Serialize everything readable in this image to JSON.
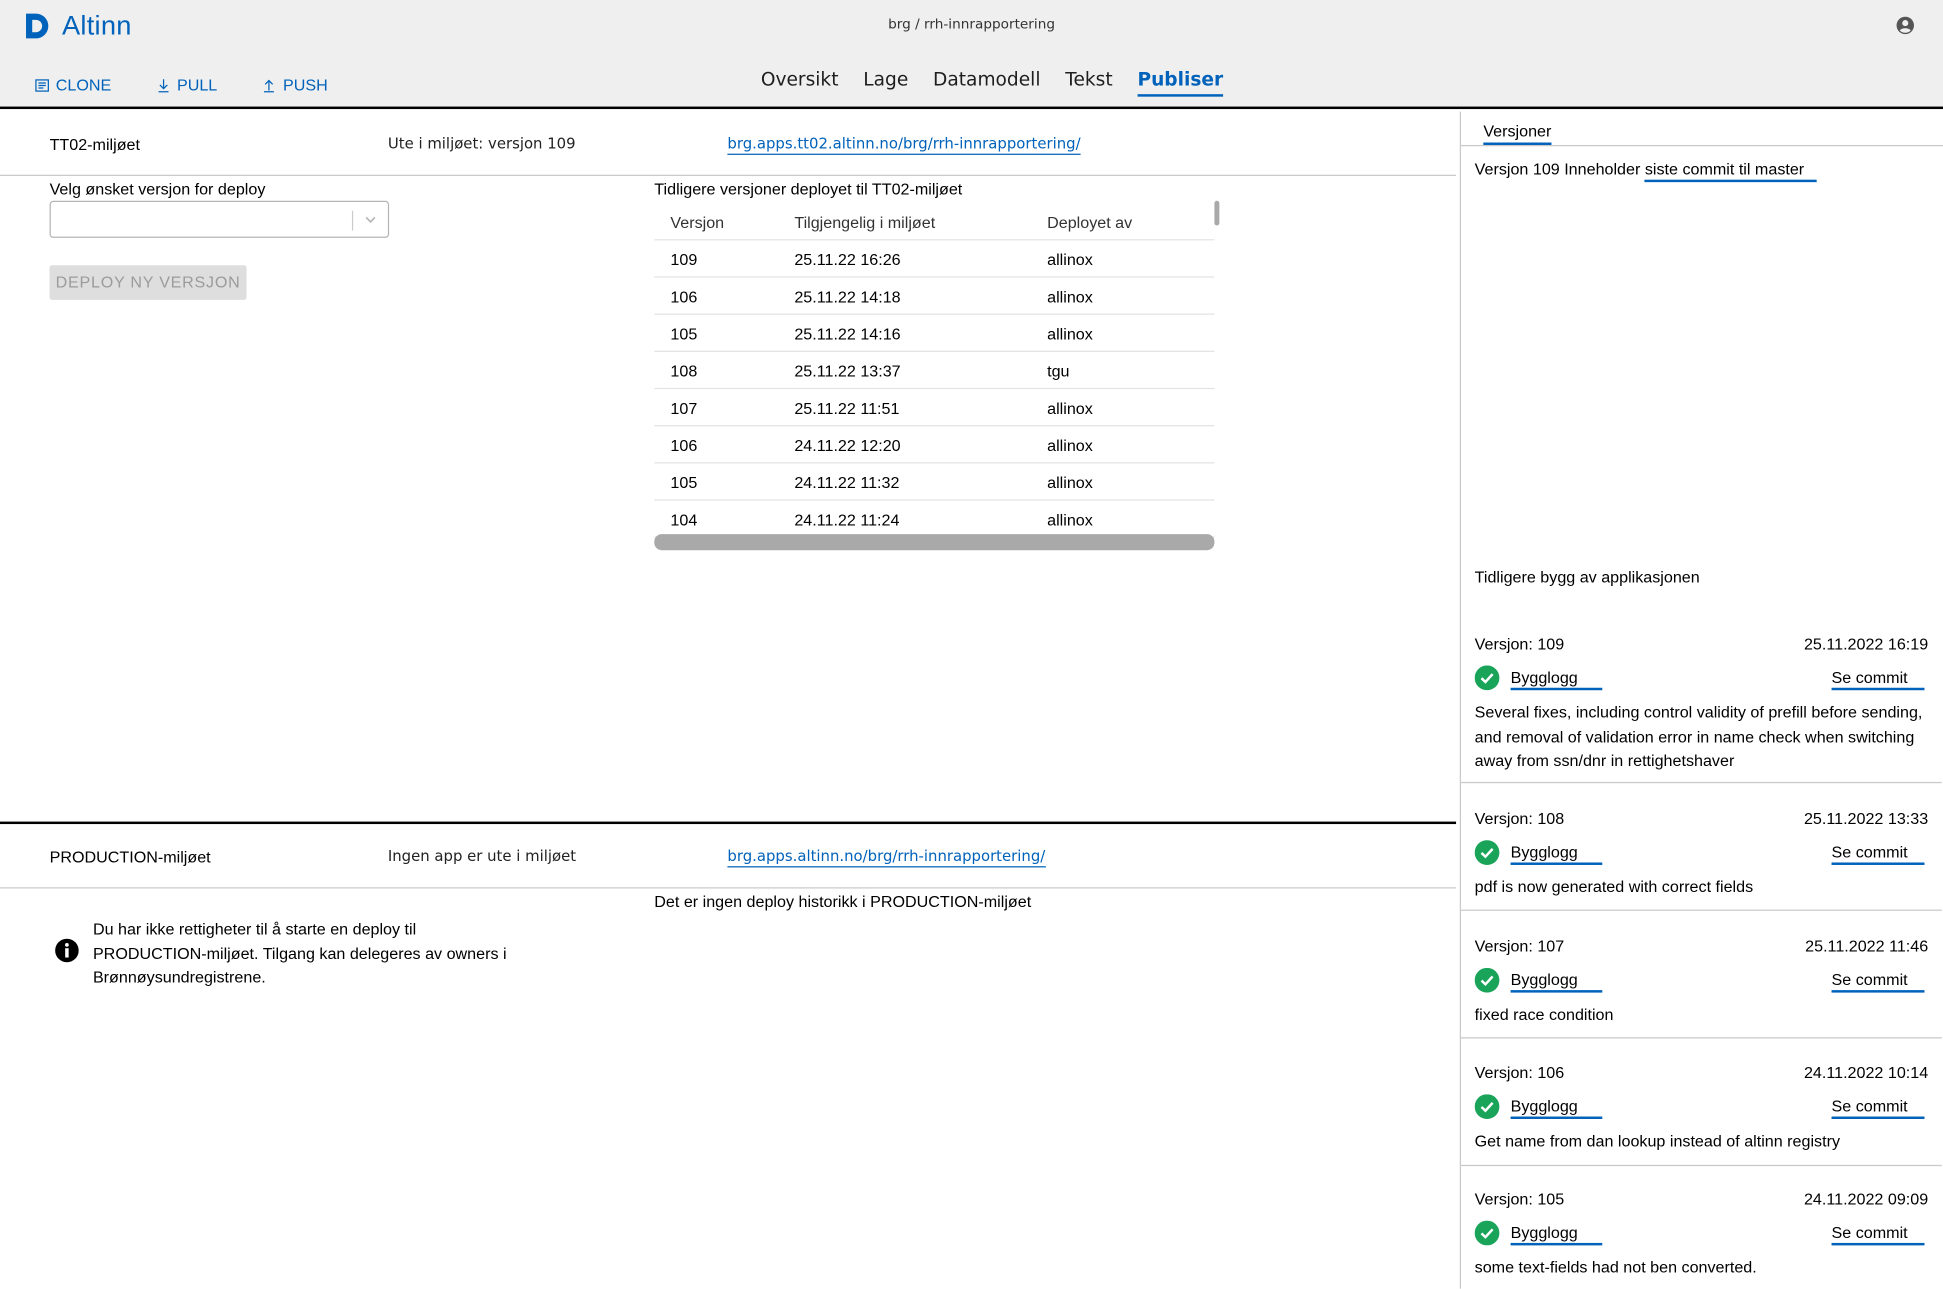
{
  "app": {
    "name": "Altinn",
    "repo_path": "brg / rrh-innrapportering"
  },
  "repo_actions": [
    {
      "label": "CLONE",
      "icon": "clone-icon"
    },
    {
      "label": "PULL",
      "icon": "download-icon"
    },
    {
      "label": "PUSH",
      "icon": "upload-icon"
    }
  ],
  "nav": {
    "items": [
      "Oversikt",
      "Lage",
      "Datamodell",
      "Tekst",
      "Publiser"
    ],
    "active": "Publiser"
  },
  "tt02": {
    "name": "TT02-miljøet",
    "status": "Ute i miljøet: versjon 109",
    "link": "brg.apps.tt02.altinn.no/brg/rrh-innrapportering/",
    "select_label": "Velg ønsket versjon for deploy",
    "select_value": "",
    "deploy_button": "DEPLOY NY VERSJON",
    "history_title": "Tidligere versjoner deployet til TT02-miljøet",
    "history_columns": [
      "Versjon",
      "Tilgjengelig i miljøet",
      "Deployet av"
    ],
    "history_rows": [
      [
        "109",
        "25.11.22 16:26",
        "allinox"
      ],
      [
        "106",
        "25.11.22 14:18",
        "allinox"
      ],
      [
        "105",
        "25.11.22 14:16",
        "allinox"
      ],
      [
        "108",
        "25.11.22 13:37",
        "tgu"
      ],
      [
        "107",
        "25.11.22 11:51",
        "allinox"
      ],
      [
        "106",
        "24.11.22 12:20",
        "allinox"
      ],
      [
        "105",
        "24.11.22 11:32",
        "allinox"
      ],
      [
        "104",
        "24.11.22 11:24",
        "allinox"
      ]
    ]
  },
  "production": {
    "name": "PRODUCTION-miljøet",
    "status": "Ingen app er ute i miljøet",
    "link": "brg.apps.altinn.no/brg/rrh-innrapportering/",
    "no_history": "Det er ingen deploy historikk i PRODUCTION-miljøet",
    "info": "Du har ikke rettigheter til å starte en deploy til PRODUCTION-miljøet. Tilgang kan delegeres av owners i Brønnøysundregistrene."
  },
  "sidebar": {
    "tab": "Versjoner",
    "current_prefix": "Versjon 109 Inneholder",
    "current_link": "siste commit til master",
    "previous_title": "Tidligere bygg av applikasjonen",
    "log_label": "Bygglogg",
    "commit_label": "Se commit",
    "builds": [
      {
        "version": "Versjon: 109",
        "date": "25.11.2022 16:19",
        "message": "Several fixes, including control validity of prefill before sending, and removal of validation error in name check when switching away from ssn/dnr in rettighetshaver"
      },
      {
        "version": "Versjon: 108",
        "date": "25.11.2022 13:33",
        "message": "pdf is now generated with correct fields"
      },
      {
        "version": "Versjon: 107",
        "date": "25.11.2022 11:46",
        "message": "fixed race condition"
      },
      {
        "version": "Versjon: 106",
        "date": "24.11.2022 10:14",
        "message": "Get name from dan lookup instead of altinn registry"
      },
      {
        "version": "Versjon: 105",
        "date": "24.11.2022 09:09",
        "message": "some text-fields had not ben converted."
      }
    ]
  },
  "colors": {
    "accent": "#0062ba",
    "success": "#1aa45a"
  }
}
